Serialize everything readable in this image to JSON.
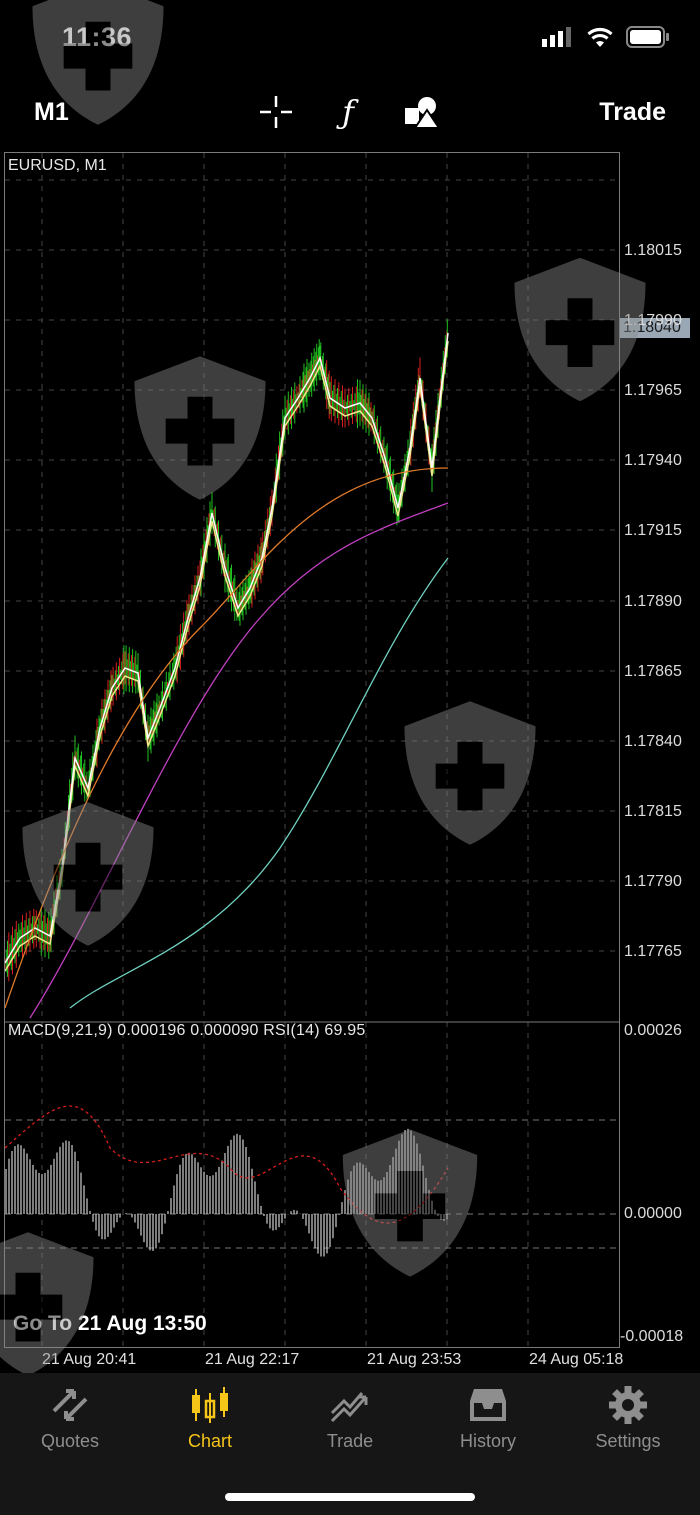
{
  "status_bar": {
    "time": "11:36"
  },
  "toolbar": {
    "period": "M1",
    "trade_label": "Trade",
    "icons": [
      "crosshair-icon",
      "function-icon",
      "objects-icon"
    ]
  },
  "chart": {
    "symbol": "EURUSD, M1",
    "current_price": "1.18040",
    "price_scale": [
      "1.18015",
      "1.17990",
      "1.17965",
      "1.17940",
      "1.17915",
      "1.17890",
      "1.17865",
      "1.17840",
      "1.17815",
      "1.17790",
      "1.17765"
    ],
    "indicator_label": "MACD(9,21,9) 0.000196 0.000090 RSI(14) 69.95",
    "indicator_scale": {
      "top": "0.00026",
      "middle": "0.00000",
      "bottom": "-0.00018"
    },
    "time_labels": [
      "21 Aug 20:41",
      "21 Aug 22:17",
      "21 Aug 23:53",
      "24 Aug 05:18"
    ],
    "goto_text": "Go To 21 Aug 13:50",
    "colors": {
      "bull": "#1fbf1f",
      "bear": "#d81e1e",
      "ma_fast": "#ffffff",
      "ma_yellow": "#f0e68c",
      "ma_orange": "#e07a2a",
      "ma_magenta": "#c040c0",
      "ma_teal": "#6fd1c0",
      "grid": "#444444",
      "frame": "#7a7a7a"
    }
  },
  "tabs": [
    {
      "label": "Quotes",
      "icon": "quotes-icon",
      "active": false
    },
    {
      "label": "Chart",
      "icon": "chart-icon",
      "active": true
    },
    {
      "label": "Trade",
      "icon": "trade-icon",
      "active": false
    },
    {
      "label": "History",
      "icon": "history-icon",
      "active": false
    },
    {
      "label": "Settings",
      "icon": "settings-icon",
      "active": false
    }
  ]
}
